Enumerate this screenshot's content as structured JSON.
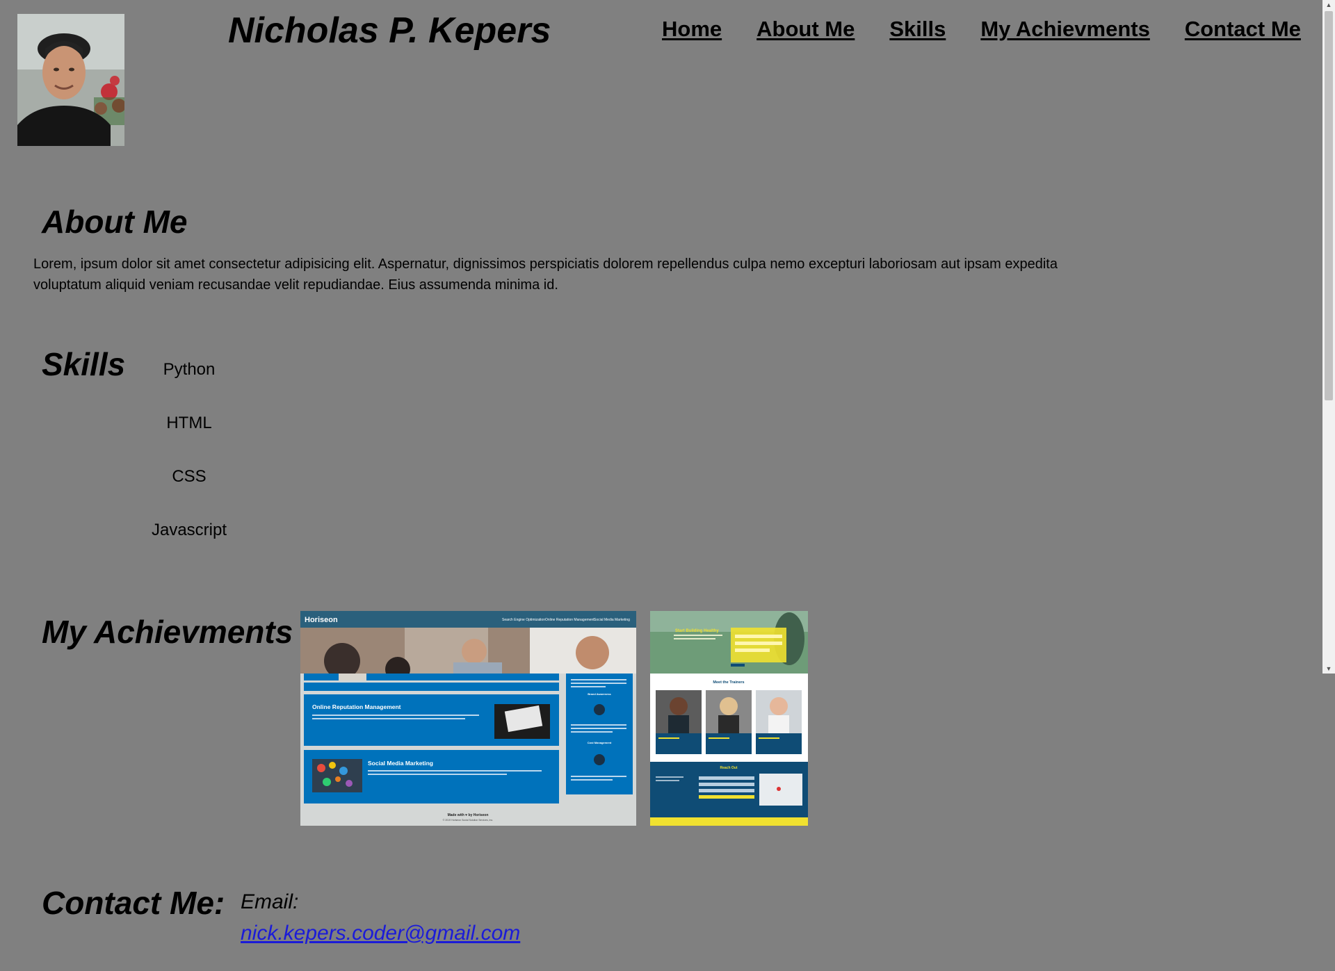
{
  "header": {
    "name": "Nicholas P. Kepers",
    "avatar_icon": "profile-photo"
  },
  "nav": [
    {
      "label": "Home"
    },
    {
      "label": "About Me"
    },
    {
      "label": "Skills"
    },
    {
      "label": "My Achievments"
    },
    {
      "label": "Contact Me"
    }
  ],
  "about": {
    "heading": "About Me",
    "text": "Lorem, ipsum dolor sit amet consectetur adipisicing elit. Aspernatur, dignissimos perspiciatis dolorem repellendus culpa nemo excepturi laboriosam aut ipsam expedita voluptatum aliquid veniam recusandae velit repudiandae. Eius assumenda minima id."
  },
  "skills": {
    "heading": "Skills",
    "items": [
      "Python",
      "HTML",
      "CSS",
      "Javascript"
    ]
  },
  "achievements": {
    "heading": "My Achievments",
    "horiseon": {
      "brand": "Horiseon",
      "nav": [
        "Search Engine Optimization",
        "Online Reputation Management",
        "Social Media Marketing"
      ],
      "cards": [
        "Online Reputation Management",
        "Social Media Marketing"
      ],
      "side_titles": [
        "Brand Awareness",
        "Cost Management"
      ],
      "footer": "Made with ♥ by Horiseon",
      "copyright": "© 2019 Horiseon Social Solution Services, Inc."
    },
    "fitness": {
      "hero_title": "Start Building Healthy",
      "section_title": "Meet the Trainers",
      "reach_title": "Reach Out"
    }
  },
  "contact": {
    "heading": "Contact Me:",
    "email_label": "Email:",
    "email": "nick.kepers.coder@gmail.com"
  },
  "colors": {
    "background": "#808080",
    "link": "#1b1bd8",
    "horiseon_blue": "#0072bb",
    "horiseon_header": "#2a607c",
    "fitness_navy": "#0f4c75",
    "fitness_yellow": "#f0e130"
  }
}
